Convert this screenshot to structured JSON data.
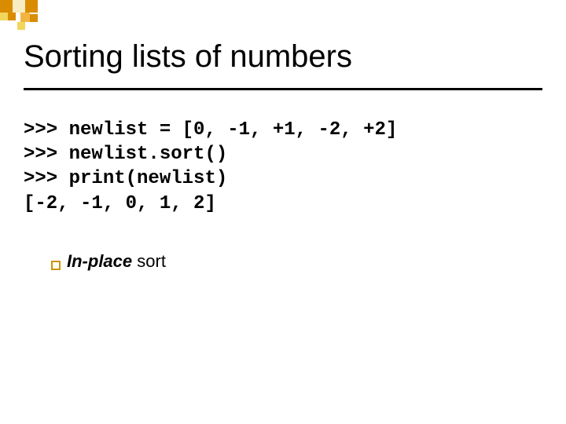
{
  "title": "Sorting lists of numbers",
  "code": {
    "lines": [
      ">>> newlist = [0, -1, +1, -2, +2]",
      ">>> newlist.sort()",
      ">>> print(newlist)",
      "[-2, -1, 0, 1, 2]"
    ]
  },
  "bullet": {
    "strong": "In-place",
    "rest": " sort"
  },
  "deco_colors": {
    "orange": "#d98c00",
    "light_orange": "#f2b544",
    "yellow": "#f2d65c",
    "pale": "#f7ecc2"
  }
}
